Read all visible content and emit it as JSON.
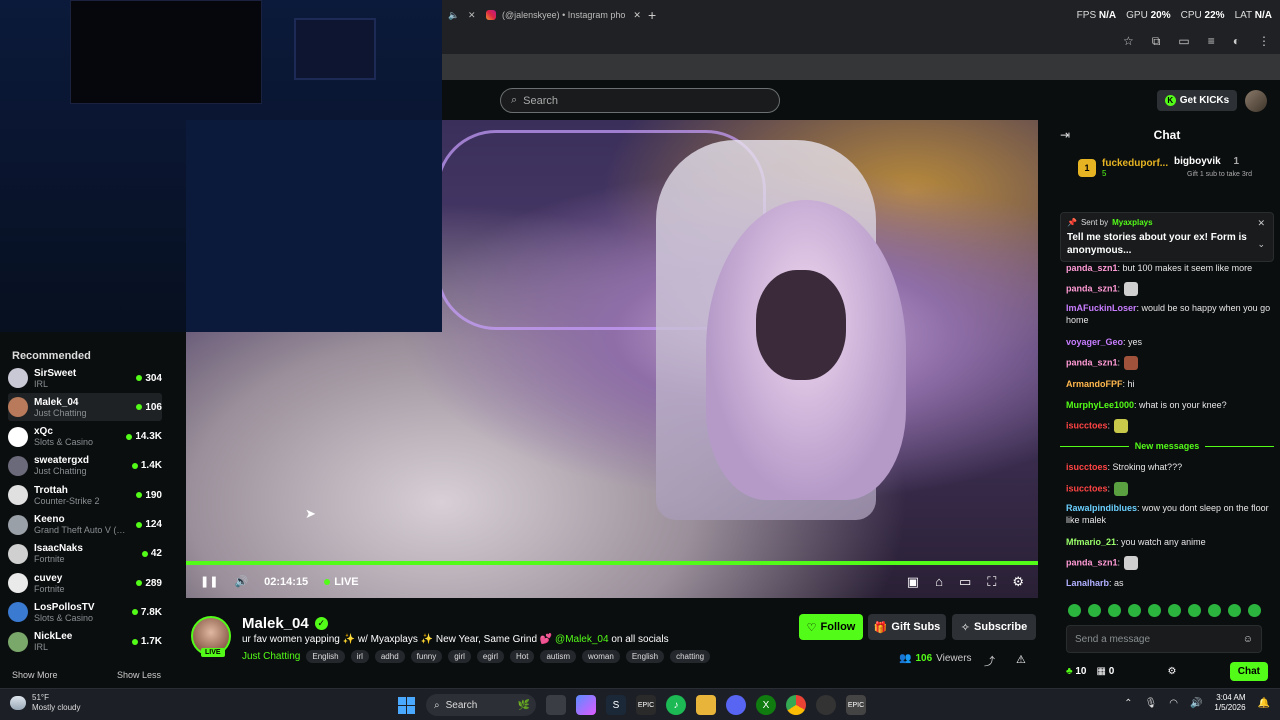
{
  "browser": {
    "active_tab_title": "(@jalenskyee) • Instagram pho",
    "stats": {
      "fps_label": "FPS",
      "fps": "N/A",
      "gpu_label": "GPU",
      "gpu": "20",
      "cpu_label": "CPU",
      "cpu": "22",
      "lat_label": "LAT",
      "lat": "N/A",
      "pct": "%"
    }
  },
  "header": {
    "search_placeholder": "Search",
    "get_kicks": "Get KICKs"
  },
  "sidebar": {
    "title": "Recommended",
    "channels": [
      {
        "name": "SirSweet",
        "category": "IRL",
        "viewers": "304",
        "color": "#c9c9d6"
      },
      {
        "name": "Malek_04",
        "category": "Just Chatting",
        "viewers": "106",
        "color": "#b87a5a"
      },
      {
        "name": "xQc",
        "category": "Slots & Casino",
        "viewers": "14.3K",
        "color": "#ffffff"
      },
      {
        "name": "sweatergxd",
        "category": "Just Chatting",
        "viewers": "1.4K",
        "color": "#6a6a7a"
      },
      {
        "name": "Trottah",
        "category": "Counter-Strike 2",
        "viewers": "190",
        "color": "#e0e0e0"
      },
      {
        "name": "Keeno",
        "category": "Grand Theft Auto V (G...",
        "viewers": "124",
        "color": "#9aa0a8"
      },
      {
        "name": "IsaacNaks",
        "category": "Fortnite",
        "viewers": "42",
        "color": "#d0d0d0"
      },
      {
        "name": "cuvey",
        "category": "Fortnite",
        "viewers": "289",
        "color": "#eaeaea"
      },
      {
        "name": "LosPollosTV",
        "category": "Slots & Casino",
        "viewers": "7.8K",
        "color": "#3a7ad0"
      },
      {
        "name": "NickLee",
        "category": "IRL",
        "viewers": "1.7K",
        "color": "#7aa86a"
      }
    ],
    "show_more": "Show More",
    "show_less": "Show Less"
  },
  "player": {
    "time": "02:14:15",
    "live": "LIVE",
    "progress": 1.0
  },
  "stream": {
    "streamer": "Malek_04",
    "live_badge": "LIVE",
    "title_main": "ur fav women yapping ✨ w/ Myaxplays ✨ New Year, Same Grind 💕 ",
    "title_mention": "@Malek_04",
    "title_tail": " on all socials",
    "category": "Just Chatting",
    "tags": [
      "English",
      "irl",
      "adhd",
      "funny",
      "girl",
      "egirl",
      "Hot",
      "autism",
      "woman",
      "English",
      "chatting"
    ],
    "follow": "Follow",
    "gift_subs": "Gift Subs",
    "subscribe": "Subscribe",
    "viewers": "106",
    "viewers_label": "Viewers"
  },
  "chat": {
    "title": "Chat",
    "leader1_name": "fuckeduporf...",
    "leader1_sub": "5",
    "leader2_name": "bigboyvik",
    "leader2_count": "1",
    "leader2_sub": "Gift 1 sub to take 3rd",
    "pinned_sent_by": "Sent by",
    "pinned_user": "Myaxplays",
    "pinned_message": "Tell me stories about your ex! Form is anonymous...",
    "messages": [
      {
        "user": "panda_szn1",
        "text": ": but 100 makes it seem like more",
        "color": "#ff9ad5"
      },
      {
        "user": "panda_szn1",
        "text": ":",
        "color": "#ff9ad5",
        "emote": "#cfcfcf"
      },
      {
        "user": "ImAFuckinLoser",
        "text": ": would be so happy when you go home",
        "color": "#c77dff"
      },
      {
        "user": "voyager_Geo",
        "text": ": yes",
        "color": "#c77dff"
      },
      {
        "user": "panda_szn1",
        "text": ":",
        "color": "#ff9ad5",
        "emote": "#a0523a"
      },
      {
        "user": "ArmandoFPF",
        "text": ": hi",
        "color": "#ffb84d"
      },
      {
        "user": "MurphyLee1000",
        "text": ": what is on your knee?",
        "color": "#53fc18"
      },
      {
        "user": "isucctoes",
        "text": ":",
        "color": "#ff4444",
        "emote": "#c8c84a"
      },
      {
        "user": "isucctoes",
        "text": ": Stroking what???",
        "color": "#ff4444"
      },
      {
        "user": "isucctoes",
        "text": ":",
        "color": "#ff4444",
        "emote": "#5aa040"
      },
      {
        "user": "Rawalpindiblues",
        "text": ": wow you dont sleep on the floor like malek",
        "color": "#6ad0ff"
      },
      {
        "user": "Mfmario_21",
        "text": ": you watch any anime",
        "color": "#9aff6a"
      },
      {
        "user": "panda_szn1",
        "text": ":",
        "color": "#ff9ad5",
        "emote": "#cfcfcf"
      },
      {
        "user": "Lanalharb",
        "text": ": as",
        "color": "#b0b0ff"
      }
    ],
    "new_messages": "New messages",
    "input_placeholder": "Send a message",
    "kicks": "10",
    "gifts": "0",
    "chat_button": "Chat"
  },
  "taskbar": {
    "temp": "51°F",
    "weather": "Mostly cloudy",
    "search": "Search",
    "time": "3:04 AM",
    "date": "1/5/2026"
  },
  "colors": {
    "accent": "#53fc18",
    "bg": "#0b0e0f",
    "panel": "#191b1c"
  }
}
